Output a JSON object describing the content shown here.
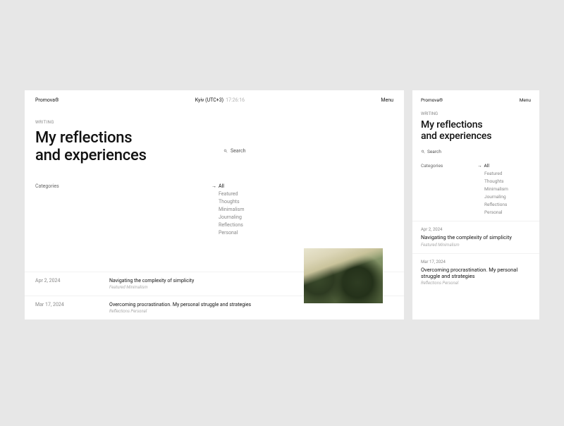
{
  "brand": "Promova®",
  "menu_label": "Menu",
  "location": "Kyiv (UTC+3)",
  "time": "17:26:16",
  "section": "WRITING",
  "title_line1": "My reflections",
  "title_line2": "and experiences",
  "search_label": "Search",
  "categories_label": "Categories",
  "categories": [
    {
      "label": "All",
      "active": true
    },
    {
      "label": "Featured",
      "active": false
    },
    {
      "label": "Thoughts",
      "active": false
    },
    {
      "label": "Minimalism",
      "active": false
    },
    {
      "label": "Journaling",
      "active": false
    },
    {
      "label": "Reflections",
      "active": false
    },
    {
      "label": "Personal",
      "active": false
    }
  ],
  "articles": [
    {
      "date": "Apr 2, 2024",
      "title": "Navigating the complexity of simplicity",
      "tags": "Featured   Minimalism"
    },
    {
      "date": "Mar 17, 2024",
      "title": "Overcoming procrastination. My personal struggle and strategies",
      "tags": "Reflections   Personal"
    }
  ]
}
